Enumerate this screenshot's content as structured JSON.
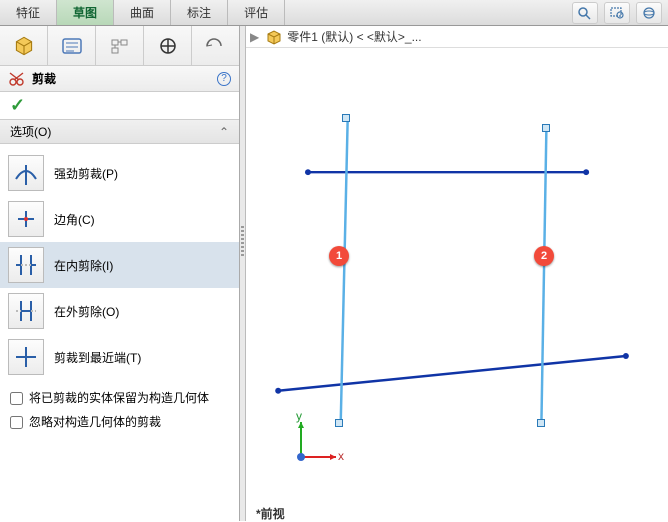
{
  "tabs": {
    "items": [
      "特征",
      "草图",
      "曲面",
      "标注",
      "评估"
    ],
    "active": 1
  },
  "command": {
    "title": "剪裁",
    "ok_glyph": "✓",
    "help_glyph": "?"
  },
  "section": {
    "title": "选项(O)",
    "chevron": "⌃"
  },
  "options": [
    {
      "label": "强劲剪裁(P)"
    },
    {
      "label": "边角(C)"
    },
    {
      "label": "在内剪除(I)"
    },
    {
      "label": "在外剪除(O)"
    },
    {
      "label": "剪裁到最近端(T)"
    }
  ],
  "checks": {
    "keep_as_construction": "将已剪裁的实体保留为构造几何体",
    "ignore_construction": "忽略对构造几何体的剪裁"
  },
  "viewport": {
    "breadcrumb_tri": "▶",
    "part_name": "零件1 (默认) < <默认>_...",
    "markers": [
      "1",
      "2"
    ],
    "axis_x": "x",
    "axis_y": "y",
    "footer": "*前视"
  }
}
